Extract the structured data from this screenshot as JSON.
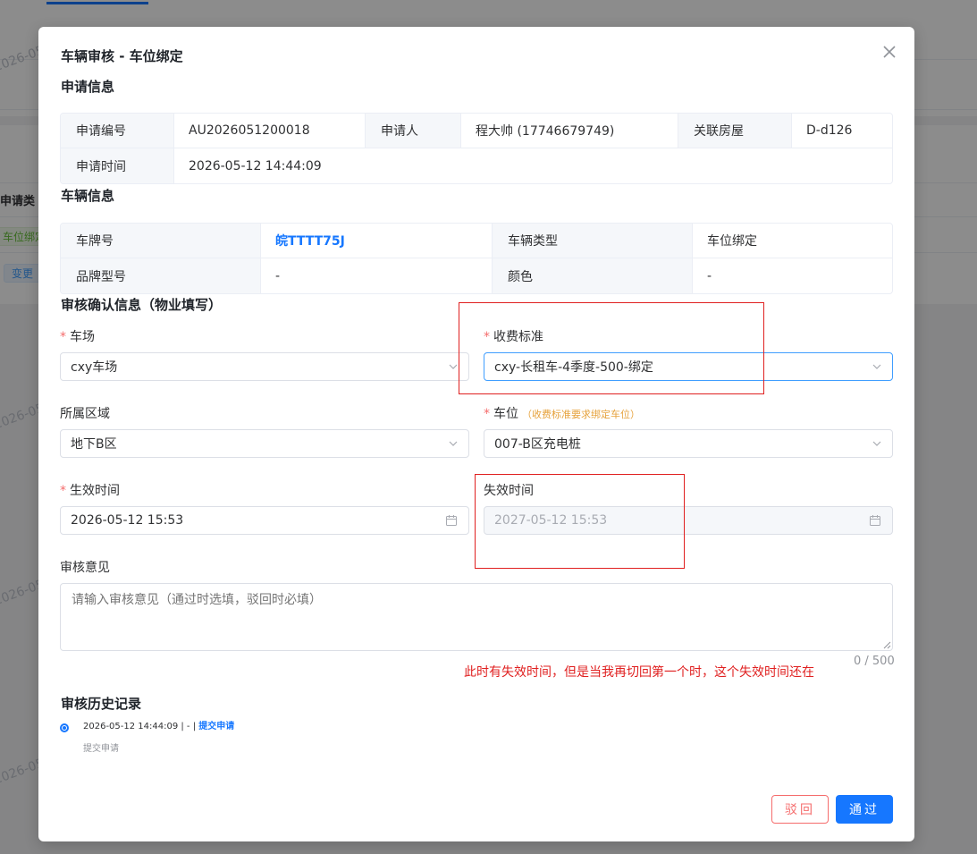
{
  "background": {
    "column_label": "申请类",
    "tag_type": "车位绑定",
    "tag_change": "变更",
    "watermark": "2026-05"
  },
  "dialog": {
    "title": "车辆审核 - 车位绑定",
    "sections": {
      "application": "申请信息",
      "vehicle": "车辆信息",
      "review": "审核确认信息（物业填写）",
      "history": "审核历史记录"
    },
    "application_info": {
      "labels": {
        "number": "申请编号",
        "applicant": "申请人",
        "house": "关联房屋",
        "time": "申请时间"
      },
      "values": {
        "number": "AU2026051200018",
        "applicant": "程大帅 (17746679749)",
        "house": "D-d126",
        "time": "2026-05-12 14:44:09"
      }
    },
    "vehicle_info": {
      "labels": {
        "plate": "车牌号",
        "type": "车辆类型",
        "brand": "品牌型号",
        "color": "颜色"
      },
      "values": {
        "plate": "皖TTTT75J",
        "type": "车位绑定",
        "brand": "-",
        "color": "-"
      }
    },
    "form": {
      "parking_lot": {
        "label": "车场",
        "required": true,
        "value": "cxy车场"
      },
      "fee_standard": {
        "label": "收费标准",
        "required": true,
        "value": "cxy-长租车-4季度-500-绑定"
      },
      "area": {
        "label": "所属区域",
        "required": false,
        "value": "地下B区"
      },
      "space": {
        "label": "车位",
        "required": true,
        "hint": "（收费标准要求绑定车位）",
        "value": "007-B区充电桩"
      },
      "start_time": {
        "label": "生效时间",
        "required": true,
        "value": "2026-05-12 15:53"
      },
      "end_time": {
        "label": "失效时间",
        "required": false,
        "value": "2027-05-12 15:53"
      },
      "opinion": {
        "label": "审核意见",
        "placeholder": "请输入审核意见（通过时选填，驳回时必填）",
        "counter": "0 / 500"
      }
    },
    "required_mark": "*",
    "annotation": "此时有失效时间，但是当我再切回第一个时，这个失效时间还在",
    "history": [
      {
        "meta": "2026-05-12 14:44:09 | - | ",
        "action": "提交申请",
        "desc": "提交申请"
      }
    ],
    "buttons": {
      "reject": "驳回",
      "approve": "通过"
    },
    "icons": [
      "close-icon",
      "chevron-down-icon",
      "calendar-icon"
    ]
  }
}
